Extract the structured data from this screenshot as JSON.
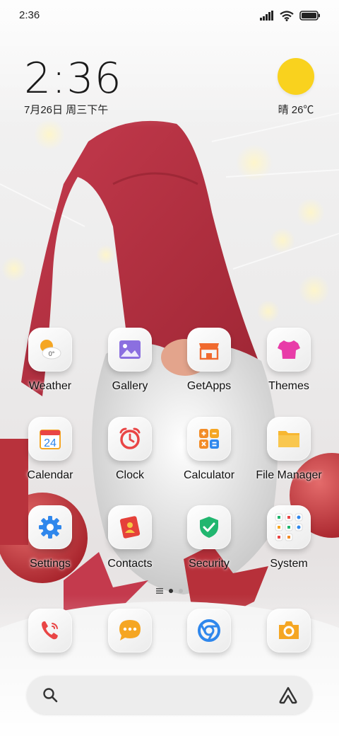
{
  "status_bar": {
    "time": "2:36"
  },
  "clock_widget": {
    "time": "2:36",
    "date": "7月26日 周三下午"
  },
  "weather_widget": {
    "temp": "晴 26℃",
    "icon": "sunny-icon"
  },
  "apps": [
    {
      "name": "weather-app",
      "label": "Weather",
      "icon": "weather-icon",
      "color": "#f5a623"
    },
    {
      "name": "gallery-app",
      "label": "Gallery",
      "icon": "gallery-icon",
      "color": "#8b6fe0"
    },
    {
      "name": "getapps-app",
      "label": "GetApps",
      "icon": "store-icon",
      "color": "#f06a2f"
    },
    {
      "name": "themes-app",
      "label": "Themes",
      "icon": "shirt-icon",
      "color": "#e83ca8"
    },
    {
      "name": "calendar-app",
      "label": "Calendar",
      "icon": "calendar-icon",
      "color": "#f5a623",
      "badge": "24"
    },
    {
      "name": "clock-app",
      "label": "Clock",
      "icon": "alarm-clock-icon",
      "color": "#e94545"
    },
    {
      "name": "calculator-app",
      "label": "Calculator",
      "icon": "calculator-icon",
      "color": "#f28c28"
    },
    {
      "name": "filemanager-app",
      "label": "File Manager",
      "icon": "folder-icon",
      "color": "#f7b731"
    },
    {
      "name": "settings-app",
      "label": "Settings",
      "icon": "gear-icon",
      "color": "#2f87ec"
    },
    {
      "name": "contacts-app",
      "label": "Contacts",
      "icon": "contacts-icon",
      "color": "#e5413a"
    },
    {
      "name": "security-app",
      "label": "Security",
      "icon": "shield-icon",
      "color": "#21b66f"
    },
    {
      "name": "system-folder",
      "label": "System",
      "icon": "folder-grid-icon",
      "color": "#ffffff"
    }
  ],
  "dock": [
    {
      "name": "phone-app",
      "icon": "phone-icon",
      "color": "#e94545"
    },
    {
      "name": "messages-app",
      "icon": "message-icon",
      "color": "#f5a623"
    },
    {
      "name": "browser-app",
      "icon": "browser-icon",
      "color": "#2f87ec"
    },
    {
      "name": "camera-app",
      "icon": "camera-icon",
      "color": "#f5a623"
    }
  ],
  "search_bar": {
    "left_icon": "search-icon",
    "right_icon": "assistant-icon"
  },
  "page_indicator": {
    "pages": 2,
    "current": 1
  }
}
